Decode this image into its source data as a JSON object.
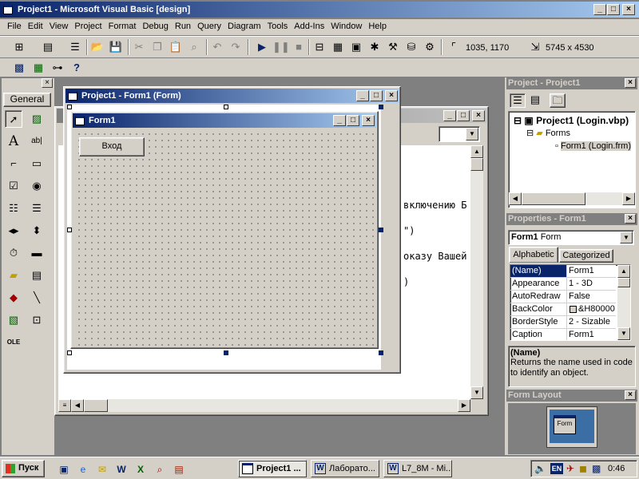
{
  "window": {
    "title": "Project1 - Microsoft Visual Basic [design]"
  },
  "menu": [
    "File",
    "Edit",
    "View",
    "Project",
    "Format",
    "Debug",
    "Run",
    "Query",
    "Diagram",
    "Tools",
    "Add-Ins",
    "Window",
    "Help"
  ],
  "toolbar": {
    "position": "1035, 1170",
    "size": "5745 x 4530"
  },
  "toolbox": {
    "tab": "General"
  },
  "designer": {
    "title": "Project1 - Form1 (Form)",
    "form_title": "Form1",
    "button_label": "Вход"
  },
  "code": {
    "lines": [
      "включению Б",
      "\")",
      "оказу Вашей",
      ")"
    ]
  },
  "project": {
    "title": "Project - Project1",
    "root": "Project1 (Login.vbp)",
    "folder": "Forms",
    "item": "Form1 (Login.frm)"
  },
  "properties": {
    "title": "Properties - Form1",
    "object": "Form1",
    "object_type": "Form",
    "tabs": [
      "Alphabetic",
      "Categorized"
    ],
    "rows": [
      {
        "name": "(Name)",
        "value": "Form1"
      },
      {
        "name": "Appearance",
        "value": "1 - 3D"
      },
      {
        "name": "AutoRedraw",
        "value": "False"
      },
      {
        "name": "BackColor",
        "value": "&H80000"
      },
      {
        "name": "BorderStyle",
        "value": "2 - Sizable"
      },
      {
        "name": "Caption",
        "value": "Form1"
      }
    ],
    "desc_title": "(Name)",
    "desc_text": "Returns the name used in code to identify an object."
  },
  "layout": {
    "title": "Form Layout",
    "form_label": "Form"
  },
  "taskbar": {
    "start": "Пуск",
    "tasks": [
      "Project1 ...",
      "Лаборато...",
      "L7_8M - Mi..."
    ],
    "lang": "EN",
    "clock": "0:46"
  },
  "colors": {
    "titlebar": "#0a246a",
    "face": "#d4d0c8",
    "workspace": "#808080",
    "selection": "#0a246a"
  }
}
